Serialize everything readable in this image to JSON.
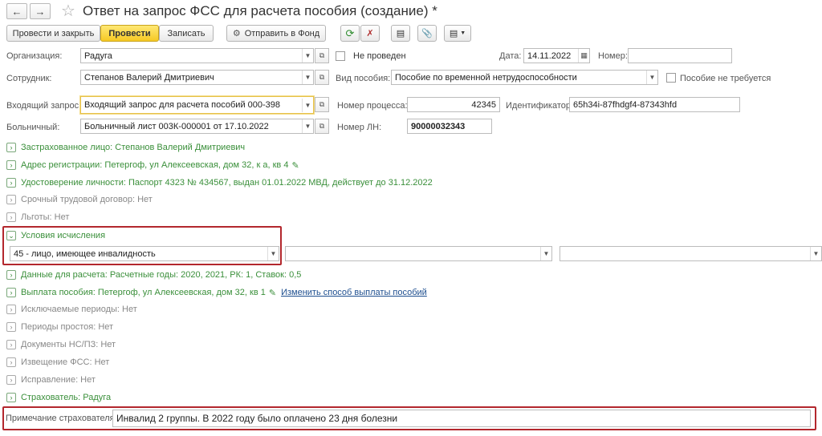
{
  "window": {
    "title": "Ответ на запрос ФСС для расчета пособия (создание) *"
  },
  "toolbar": {
    "post_close": "Провести и закрыть",
    "post": "Провести",
    "save": "Записать",
    "send_fund": "Отправить в Фонд"
  },
  "header": {
    "org_label": "Организация:",
    "org_value": "Радуга",
    "not_posted": "Не проведен",
    "date_label": "Дата:",
    "date_value": "14.11.2022",
    "number_label": "Номер:",
    "number_value": ""
  },
  "employee": {
    "label": "Сотрудник:",
    "value": "Степанов Валерий Дмитриевич",
    "benefit_type_label": "Вид пособия:",
    "benefit_type_value": "Пособие по временной нетрудоспособности",
    "not_required_label": "Пособие не требуется"
  },
  "request": {
    "label": "Входящий запрос:",
    "value": "Входящий запрос для расчета пособий 000-398",
    "process_label": "Номер процесса:",
    "process_value": "42345",
    "id_label": "Идентификатор:",
    "id_value": "65h34i-87fhdgf4-87343hfd"
  },
  "sick_leave": {
    "label": "Больничный:",
    "value": "Больничный лист 003К-000001 от 17.10.2022",
    "ln_label": "Номер ЛН:",
    "ln_value": "90000032343"
  },
  "groups": [
    {
      "text": "Застрахованное лицо: Степанов Валерий Дмитриевич",
      "color": "green"
    },
    {
      "text": "Адрес регистрации: Петергоф, ул Алексеевская, дом 32, к а, кв 4",
      "color": "green"
    },
    {
      "text": "Удостоверение личности: Паспорт 4323 № 434567, выдан 01.01.2022 МВД, действует до 31.12.2022",
      "color": "green"
    },
    {
      "text": "Срочный трудовой договор: Нет",
      "color": "grey"
    },
    {
      "text": "Льготы: Нет",
      "color": "grey"
    }
  ],
  "conditions": {
    "title": "Условия исчисления",
    "select1": "45 - лицо, имеющее инвалидность",
    "select2": "",
    "select3": ""
  },
  "groups2": [
    {
      "text": "Данные для расчета: Расчетные годы: 2020, 2021, РК: 1, Ставок: 0,5",
      "color": "green"
    },
    {
      "text": "Выплата пособия: Петергоф, ул Алексеевская, дом 32, кв 1",
      "color": "green"
    },
    {
      "text": "Исключаемые периоды: Нет",
      "color": "grey"
    },
    {
      "text": "Периоды простоя: Нет",
      "color": "grey"
    },
    {
      "text": "Документы НС/ПЗ: Нет",
      "color": "grey"
    },
    {
      "text": "Извещение ФСС: Нет",
      "color": "grey"
    },
    {
      "text": "Исправление: Нет",
      "color": "grey"
    },
    {
      "text": "Страхователь: Радуга",
      "color": "green"
    }
  ],
  "change_payment_link": "Изменить способ выплаты пособий",
  "note": {
    "label": "Примечание страхователя:",
    "value": "Инвалид 2 группы. В 2022 году было оплачено 23 дня болезни"
  }
}
